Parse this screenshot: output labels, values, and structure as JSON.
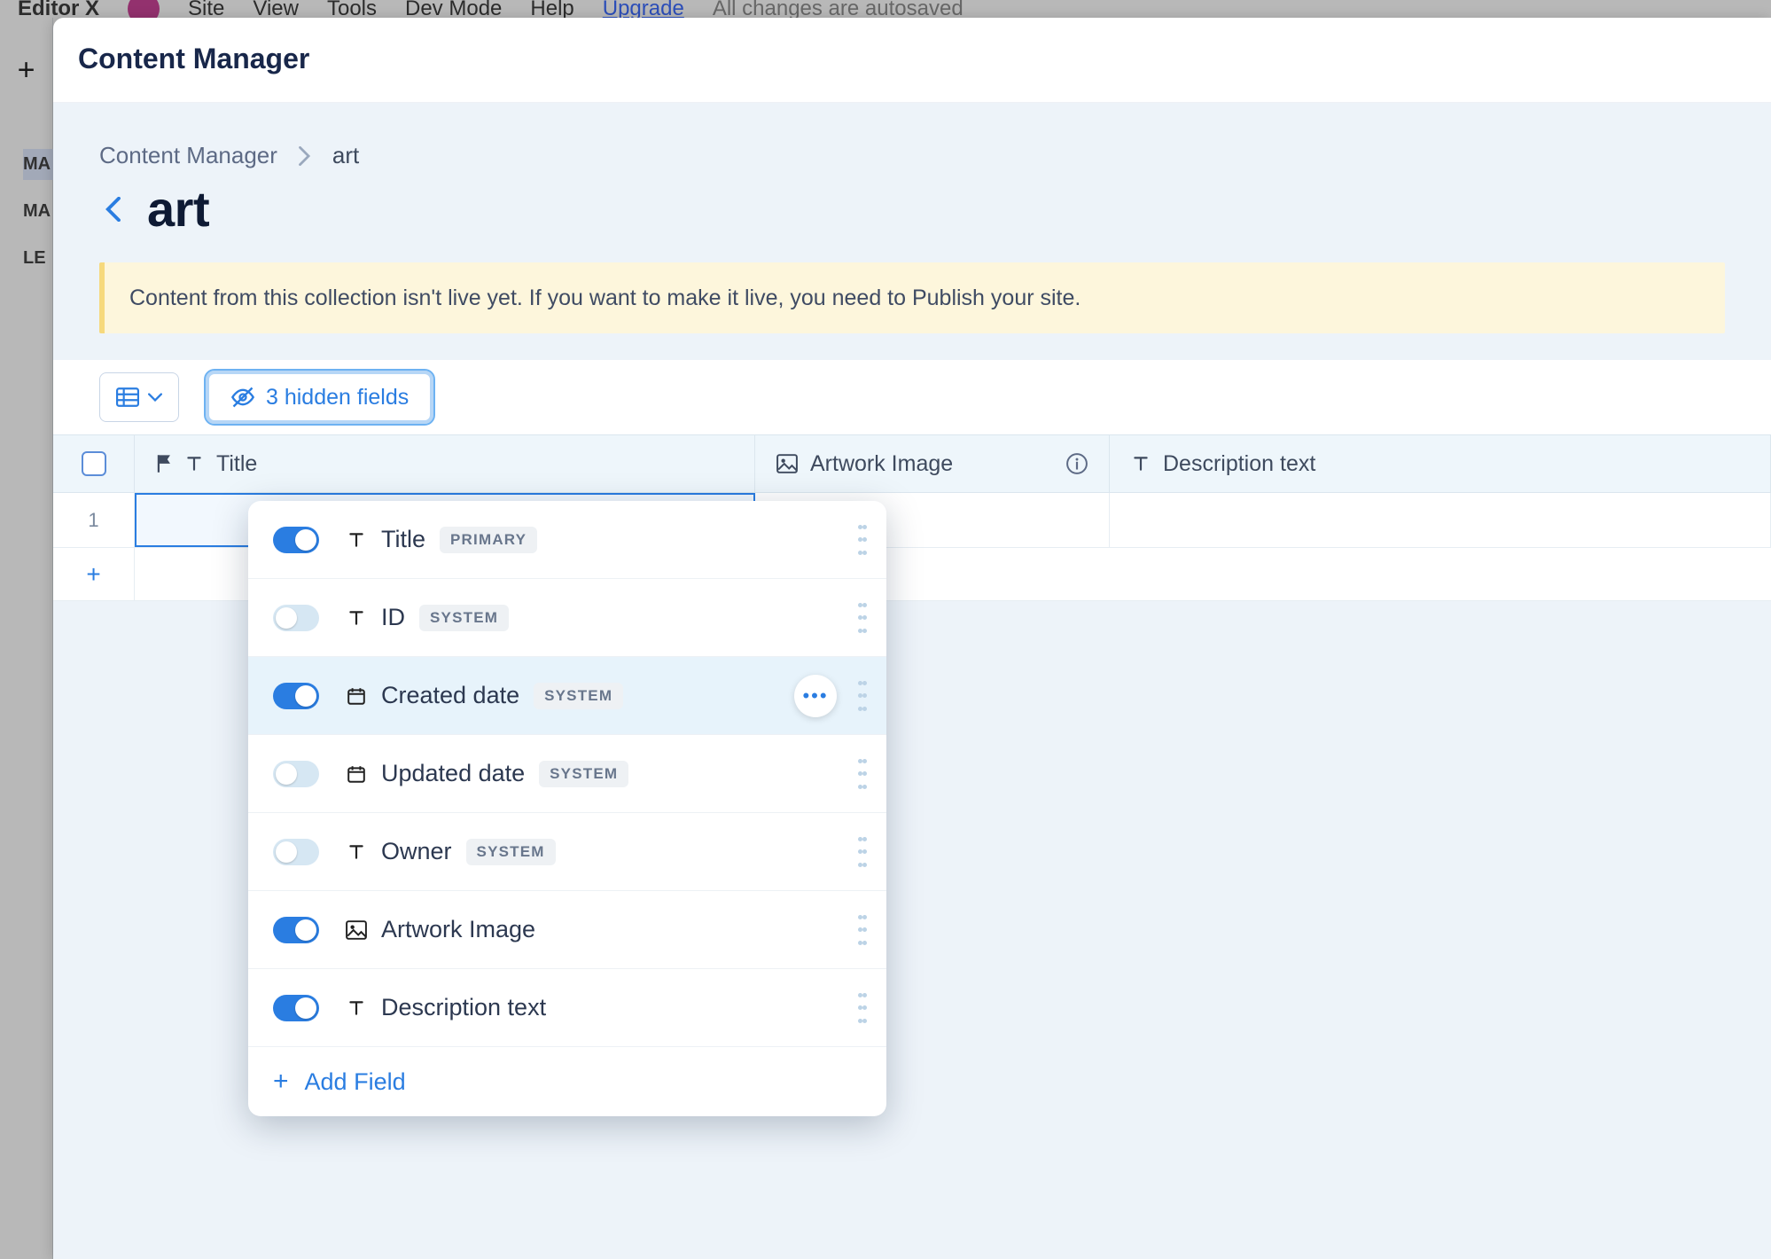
{
  "bg": {
    "brand": "Editor X",
    "menu": [
      "Site",
      "View",
      "Tools",
      "Dev Mode",
      "Help"
    ],
    "upgrade": "Upgrade",
    "autosave": "All changes are autosaved",
    "nav": [
      "MA",
      "MA",
      "LE"
    ]
  },
  "panel": {
    "title": "Content Manager"
  },
  "breadcrumb": {
    "root": "Content Manager",
    "current": "art"
  },
  "page_title": "art",
  "banner": "Content from this collection isn't live yet. If you want to make it live, you need to Publish your site.",
  "toolbar": {
    "hidden_fields_label": "3 hidden fields"
  },
  "columns": {
    "title": "Title",
    "artwork_image": "Artwork Image",
    "description": "Description text"
  },
  "row_number": "1",
  "fields_popover": {
    "items": [
      {
        "label": "Title",
        "icon": "text",
        "badge": "PRIMARY",
        "on": true
      },
      {
        "label": "ID",
        "icon": "text",
        "badge": "SYSTEM",
        "on": false
      },
      {
        "label": "Created date",
        "icon": "date",
        "badge": "SYSTEM",
        "on": true
      },
      {
        "label": "Updated date",
        "icon": "date",
        "badge": "SYSTEM",
        "on": false
      },
      {
        "label": "Owner",
        "icon": "text",
        "badge": "SYSTEM",
        "on": false
      },
      {
        "label": "Artwork Image",
        "icon": "image",
        "badge": "",
        "on": true
      },
      {
        "label": "Description text",
        "icon": "text",
        "badge": "",
        "on": true
      }
    ],
    "add_field": "Add Field"
  }
}
